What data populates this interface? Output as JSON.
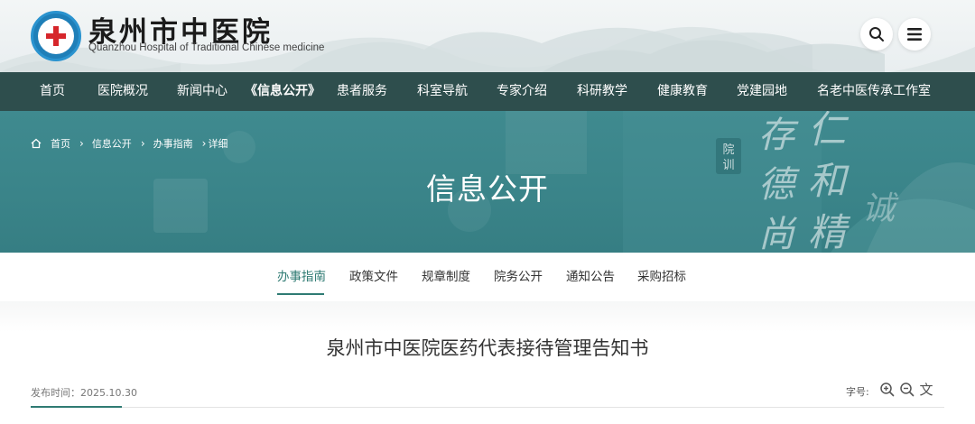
{
  "header": {
    "title": "泉州市中医院",
    "subtitle": "Quanzhou Hospital of Traditional Chinese medicine",
    "search_icon": "search-icon",
    "menu_icon": "menu-icon"
  },
  "nav": {
    "items": [
      "首页",
      "医院概况",
      "新闻中心",
      "《信息公开》",
      "患者服务",
      "科室导航",
      "专家介绍",
      "科研教学",
      "健康教育",
      "党建园地",
      "名老中医传承工作室"
    ],
    "active_index": 3
  },
  "banner": {
    "breadcrumb": [
      "首页",
      "信息公开",
      "办事指南",
      "详细"
    ],
    "title": "信息公开",
    "calligraphy": [
      "存",
      "德",
      "尚",
      "仁",
      "和",
      "精",
      "诚",
      "院",
      "训"
    ]
  },
  "subnav": {
    "items": [
      "办事指南",
      "政策文件",
      "规章制度",
      "院务公开",
      "通知公告",
      "采购招标"
    ],
    "active_index": 0
  },
  "article": {
    "title": "泉州市中医院医药代表接待管理告知书",
    "date_label": "发布时间：2025.10.30",
    "font_size_label": "字号:",
    "font_text_glyph": "文"
  },
  "colors": {
    "nav_bg": "#2e4e4d",
    "banner_bg": "#3a8489",
    "accent": "#2f7b73"
  }
}
